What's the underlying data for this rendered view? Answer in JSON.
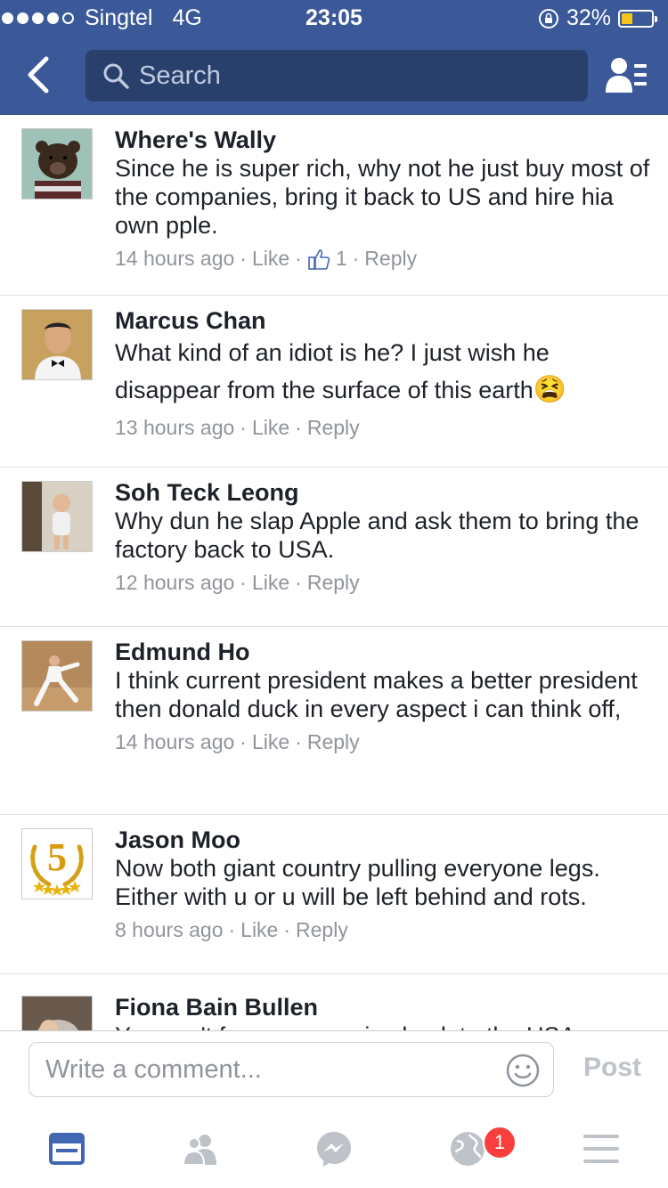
{
  "status_bar": {
    "carrier": "Singtel",
    "network": "4G",
    "time": "23:05",
    "battery": "32%",
    "battery_level": 0.32,
    "signal_bars_filled": 4,
    "signal_bars_total": 5
  },
  "nav": {
    "search_placeholder": "Search"
  },
  "comments": [
    {
      "author": "Where's Wally",
      "text": "Since he is super rich, why not he just buy most of the companies, bring it back to US and hire hia own pple.",
      "time": "14 hours ago",
      "like_label": "Like",
      "likes": "1",
      "reply_label": "Reply",
      "avatar": "bear-avatar"
    },
    {
      "author": "Marcus Chan",
      "text": "What kind of an idiot is he? I just wish he disappear from the surface of this earth",
      "emoji": "😫",
      "time": "13 hours ago",
      "like_label": "Like",
      "reply_label": "Reply",
      "avatar": "man-bowtie-avatar"
    },
    {
      "author": "Soh Teck Leong",
      "text": "Why dun he slap Apple and ask them to bring the factory back to USA.",
      "time": "12 hours ago",
      "like_label": "Like",
      "reply_label": "Reply",
      "avatar": "child-avatar"
    },
    {
      "author": "Edmund Ho",
      "text": "I think current president makes a better president then donald duck in every aspect i can think off,",
      "time": "14 hours ago",
      "like_label": "Like",
      "reply_label": "Reply",
      "avatar": "martial-arts-avatar"
    },
    {
      "author": "Jason Moo",
      "text": "Now both giant country pulling everyone legs. Either with u or u will be left behind and rots.",
      "time": "8 hours ago",
      "like_label": "Like",
      "reply_label": "Reply",
      "avatar": "five-star-laurel-avatar",
      "avatar_text": "5"
    },
    {
      "author": "Fiona Bain Bullen",
      "text": "You can't force companies back to the USA",
      "avatar": "baby-avatar"
    }
  ],
  "composer": {
    "placeholder": "Write a comment...",
    "post_label": "Post"
  },
  "tabbar": {
    "tabs": [
      "news-feed-icon",
      "friends-icon",
      "messenger-icon",
      "notifications-globe-icon",
      "menu-icon"
    ],
    "notification_badge": "1",
    "active_color": "#4267b2",
    "inactive_color": "#bec3c9"
  },
  "colors": {
    "brand": "#3b5998",
    "search_bg": "#2a406c",
    "meta_grey": "#90949c",
    "badge_red": "#fa3e3e"
  }
}
